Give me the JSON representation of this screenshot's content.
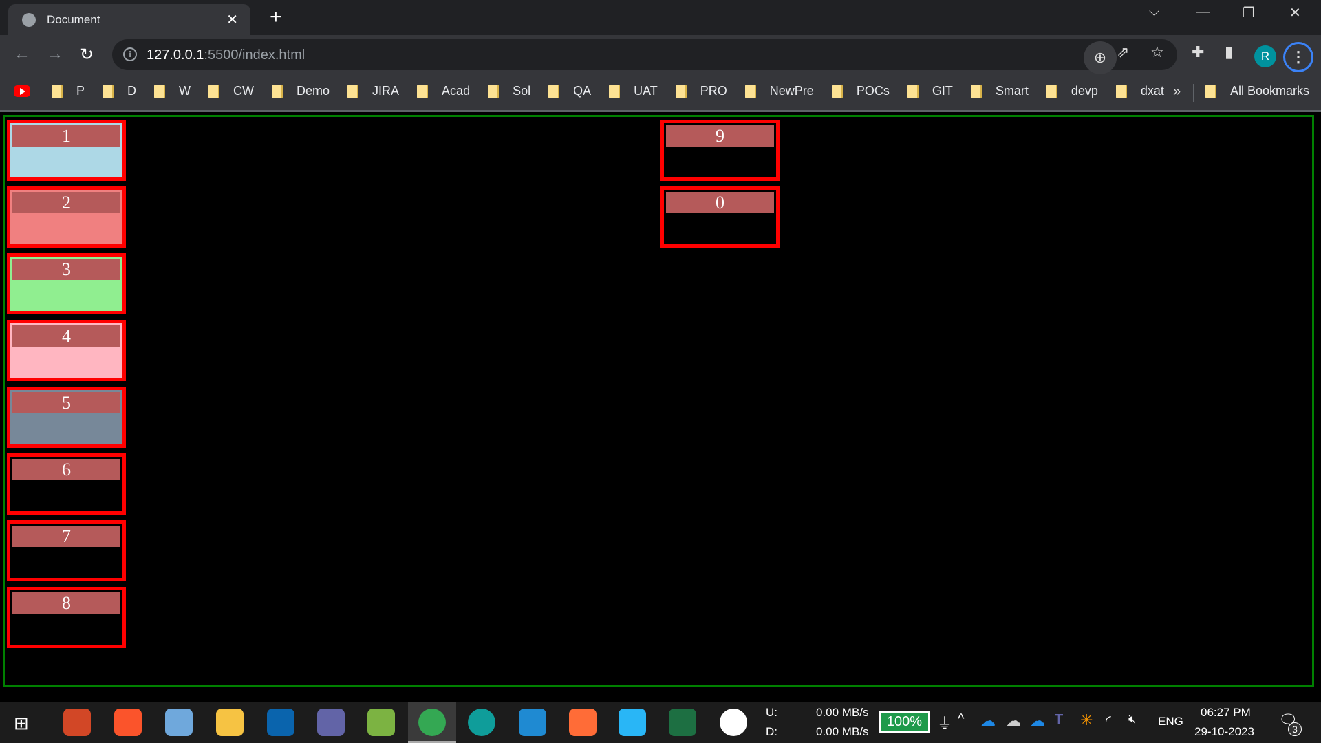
{
  "browser": {
    "tab_title": "Document",
    "url_host": "127.0.0.1",
    "url_rest": ":5500/index.html",
    "profile_initial": "R"
  },
  "bookmarks": {
    "items": [
      "P",
      "D",
      "W",
      "CW",
      "Demo",
      "JIRA",
      "Acad",
      "Sol",
      "QA",
      "UAT",
      "PRO",
      "NewPre",
      "POCs",
      "GIT",
      "Smart",
      "devp",
      "dxat"
    ],
    "overflow": "»",
    "all": "All Bookmarks"
  },
  "boxes": {
    "left": [
      {
        "label": "1",
        "color": "#add8e6"
      },
      {
        "label": "2",
        "color": "#f08080"
      },
      {
        "label": "3",
        "color": "#90ee90"
      },
      {
        "label": "4",
        "color": "#ffb6c1"
      },
      {
        "label": "5",
        "color": "#778899"
      },
      {
        "label": "6",
        "color": "#000000"
      },
      {
        "label": "7",
        "color": "#000000"
      },
      {
        "label": "8",
        "color": "#000000"
      }
    ],
    "right": [
      {
        "label": "9",
        "color": "#000000"
      },
      {
        "label": "0",
        "color": "#000000"
      }
    ]
  },
  "taskbar": {
    "upload_label": "U:",
    "upload": "0.00 MB/s",
    "download_label": "D:",
    "download": "0.00 MB/s",
    "battery": "100%",
    "lang": "ENG",
    "time": "06:27 PM",
    "date": "29-10-2023",
    "notifications": "3"
  }
}
